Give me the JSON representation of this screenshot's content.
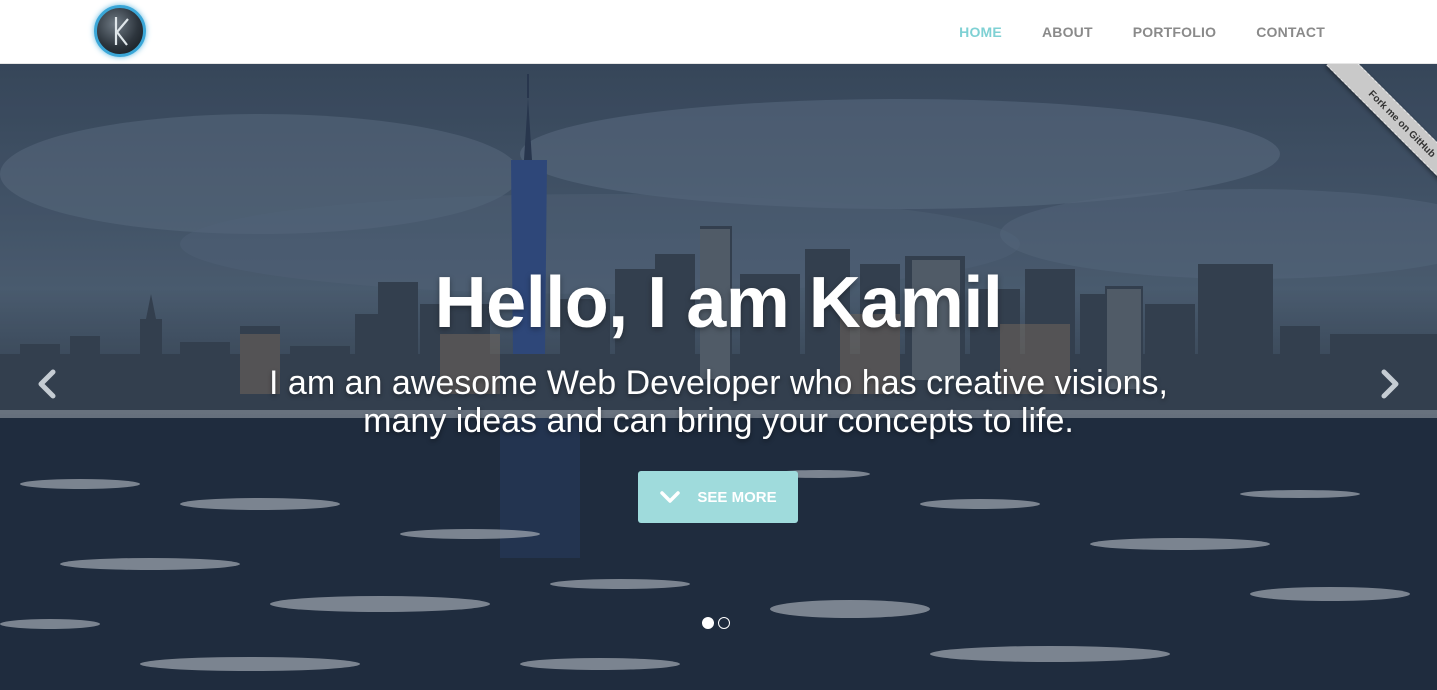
{
  "nav": {
    "logo_icon": "k-logo-icon",
    "items": [
      {
        "label": "HOME",
        "active": true
      },
      {
        "label": "ABOUT",
        "active": false
      },
      {
        "label": "PORTFOLIO",
        "active": false
      },
      {
        "label": "CONTACT",
        "active": false
      }
    ],
    "active_color": "#7fd1d4",
    "inactive_color": "#8a8a8a"
  },
  "hero": {
    "title": "Hello, I am Kamil",
    "subtitle_line1": "I am an awesome Web Developer who has creative visions,",
    "subtitle_line2": "many ideas and can bring your concepts to life.",
    "cta": {
      "label": "SEE MORE",
      "icon": "chevron-down-icon",
      "color": "#9fdbdc"
    },
    "prev_icon": "chevron-left-icon",
    "next_icon": "chevron-right-icon",
    "slides_total": 2,
    "slide_active": 1
  },
  "ribbon": {
    "label": "Fork me on GitHub"
  }
}
